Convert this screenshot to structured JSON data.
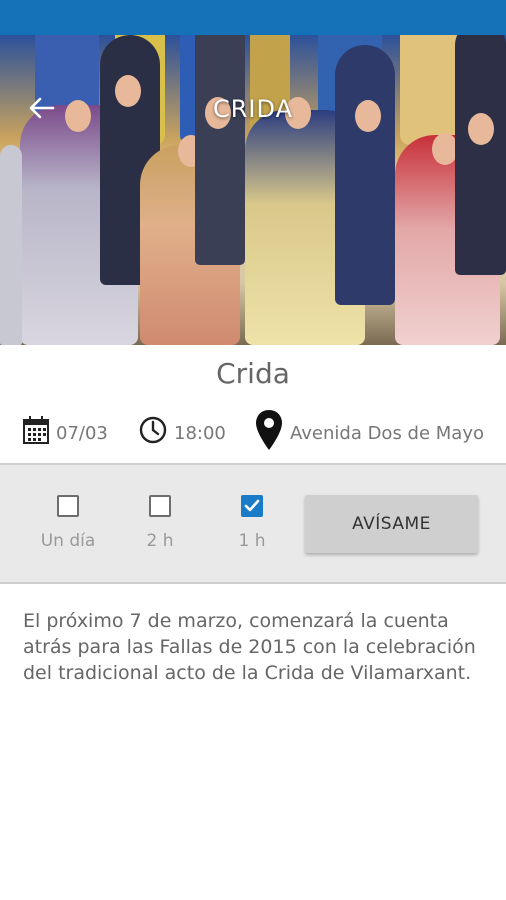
{
  "header": {
    "title": "CRIDA",
    "back_icon": "arrow-left-icon"
  },
  "event": {
    "title": "Crida",
    "date": "07/03",
    "time": "18:00",
    "location": "Avenida Dos de Mayo"
  },
  "reminder": {
    "options": [
      {
        "label": "Un día",
        "checked": false
      },
      {
        "label": "2 h",
        "checked": false
      },
      {
        "label": "1 h",
        "checked": true
      }
    ],
    "button_label": "AVÍSAME"
  },
  "description": "El próximo 7 de marzo, comenzará la cuenta atrás para las Fallas de 2015 con la celebración del tradicional acto de la Crida de Vilamarxant.",
  "colors": {
    "status_bar": "#1572b8",
    "checkbox_checked": "#1a7cc8",
    "panel_bg": "#e9e9e9"
  }
}
